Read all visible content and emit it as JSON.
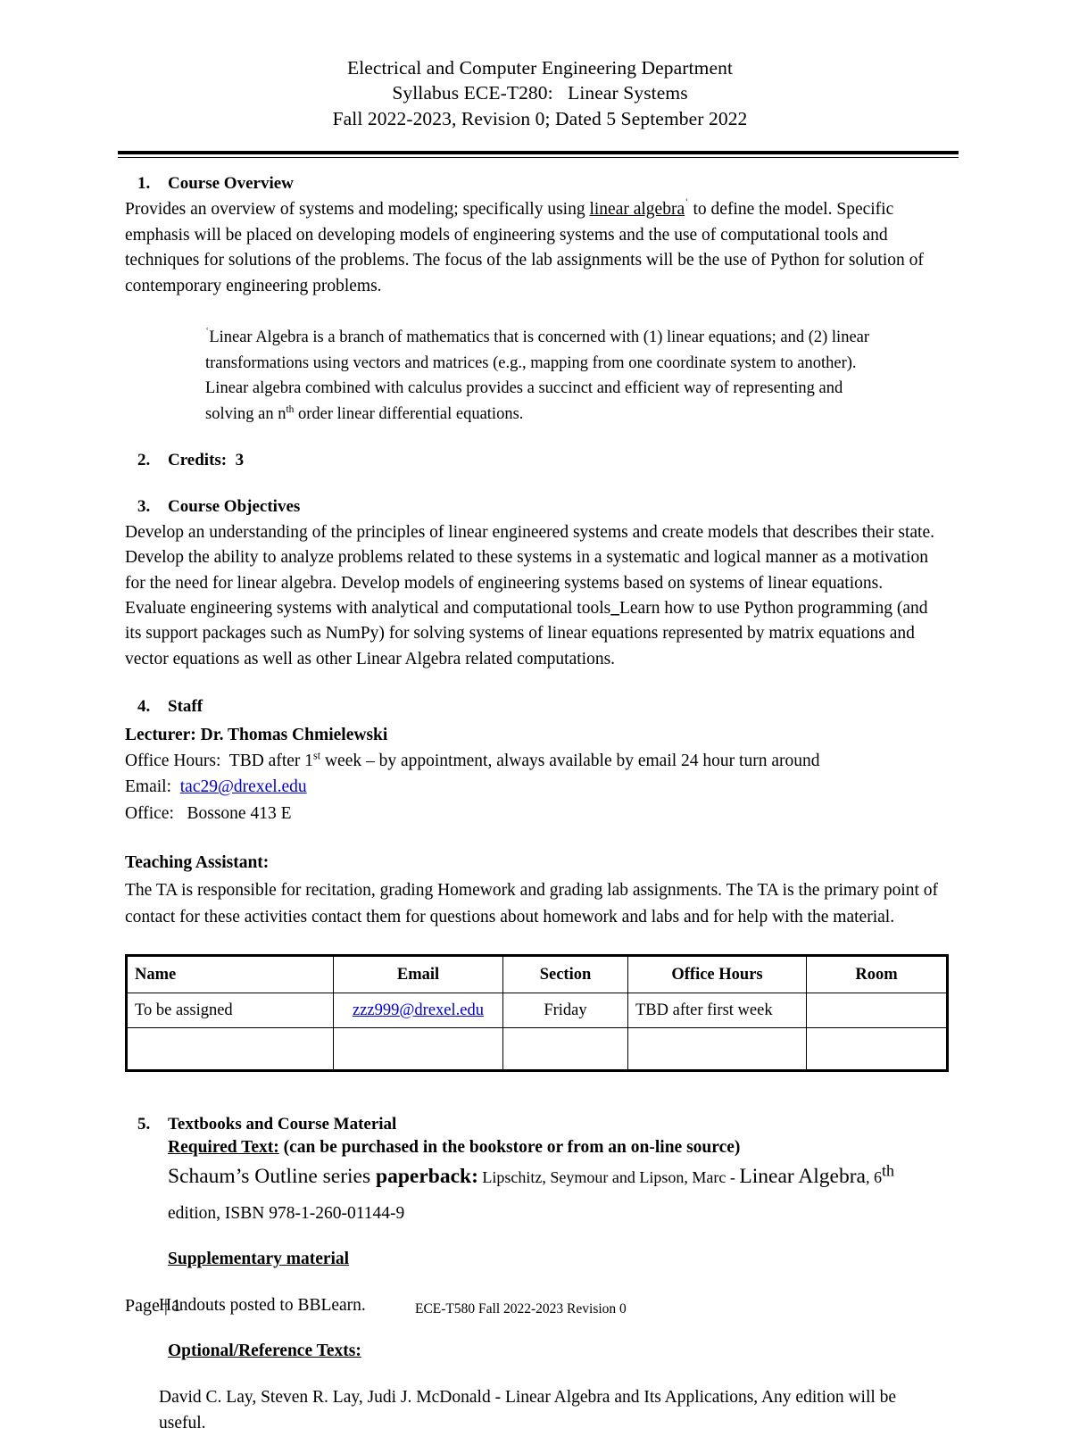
{
  "header": {
    "line1": "Electrical and Computer Engineering Department",
    "line2": "Syllabus ECE-T280:   Linear Systems",
    "line3": "Fall 2022-2023, Revision 0; Dated 5 September 2022"
  },
  "sections": {
    "overview": {
      "number": "1.",
      "title": "Course Overview",
      "text_before_link": "Provides an overview of systems and modeling; specifically using ",
      "link_text": "linear algebra",
      "footnote_mark": "ʿ",
      "text_after_link": " to define the model. Specific emphasis will be placed on developing models of engineering systems and the use of computational tools and techniques for solutions of the problems. The focus of the lab assignments will be the use of Python for solution of contemporary engineering problems.",
      "footnote": {
        "mark": "ʿ",
        "part1": "Linear Algebra is a branch of mathematics that is concerned with (1) linear equations; and (2) linear transformations using vectors and matrices (e.g., mapping from one coordinate system to another).  Linear algebra combined with calculus provides a succinct and efficient way of representing and solving an n",
        "sup": "th",
        "part2": " order linear differential equations."
      }
    },
    "credits": {
      "number": "2.",
      "title": "Credits:  3"
    },
    "objectives": {
      "number": "3.",
      "title": "Course Objectives",
      "text_part1": "Develop an understanding of the principles of linear engineered systems and create models that describes their state. Develop the ability to analyze problems related to these systems in a systematic and logical manner as a motivation for the need for linear algebra. Develop models of engineering systems based on systems of linear equations. Evaluate engineering systems with analytical and computational tools",
      "underscore": "_",
      "text_part2": "Learn how to use Python programming (and its support packages such as NumPy) for solving systems of linear equations represented by matrix equations and vector equations as well as other Linear Algebra related computations."
    },
    "staff": {
      "number": "4.",
      "title": "Staff",
      "lecturer_label": "Lecturer: Dr. Thomas Chmielewski",
      "office_hours_prefix": "Office Hours:  TBD after 1",
      "office_hours_sup": "st",
      "office_hours_suffix": " week – by appointment, always available by email 24 hour turn around",
      "email_label": "Email:  ",
      "email_value": "tac29@drexel.edu",
      "office_label": "Office:   Bossone 413 E",
      "ta_heading": "Teaching Assistant:",
      "ta_text": "The TA is responsible for recitation, grading Homework and grading lab assignments. The TA is the primary point of contact for these activities contact them for questions about homework and labs and for help with the material.",
      "table": {
        "columns": [
          "Name",
          "Email",
          "Section",
          "Office Hours",
          "Room"
        ],
        "rows": [
          {
            "name": "To be assigned",
            "email": "zzz999@drexel.edu",
            "section": "Friday",
            "office_hours": "TBD after first week",
            "room": ""
          },
          {
            "name": "",
            "email": "",
            "section": "",
            "office_hours": "",
            "room": ""
          }
        ]
      }
    },
    "textbooks": {
      "number": "5.",
      "title": "Textbooks and Course Material",
      "required_label": "Required Text:",
      "required_note": " (can be purchased in the bookstore or from an on-line source)",
      "book_part1": "Schaum’s Outline series ",
      "book_bold": "paperback:",
      "book_part2": "  Lipschitz, Seymour and Lipson, Marc - ",
      "book_title": "Linear Algebra",
      "book_part3": ", 6",
      "book_sup": "th",
      "book_edition": "edition, ISBN 978-1-260-01144-9",
      "supplementary_label": "Supplementary material",
      "supplementary_text": "Handouts posted to BBLearn.",
      "optional_label": "Optional/Reference Texts:",
      "optional_text": "David C. Lay, Steven R. Lay, Judi J. McDonald - Linear Algebra and Its Applications, Any edition will be useful."
    }
  },
  "footer": {
    "page_label": "Page",
    "page_separator": "|",
    "page_number": "1",
    "center_text": "ECE-T580 Fall 2022-2023   Revision 0"
  }
}
